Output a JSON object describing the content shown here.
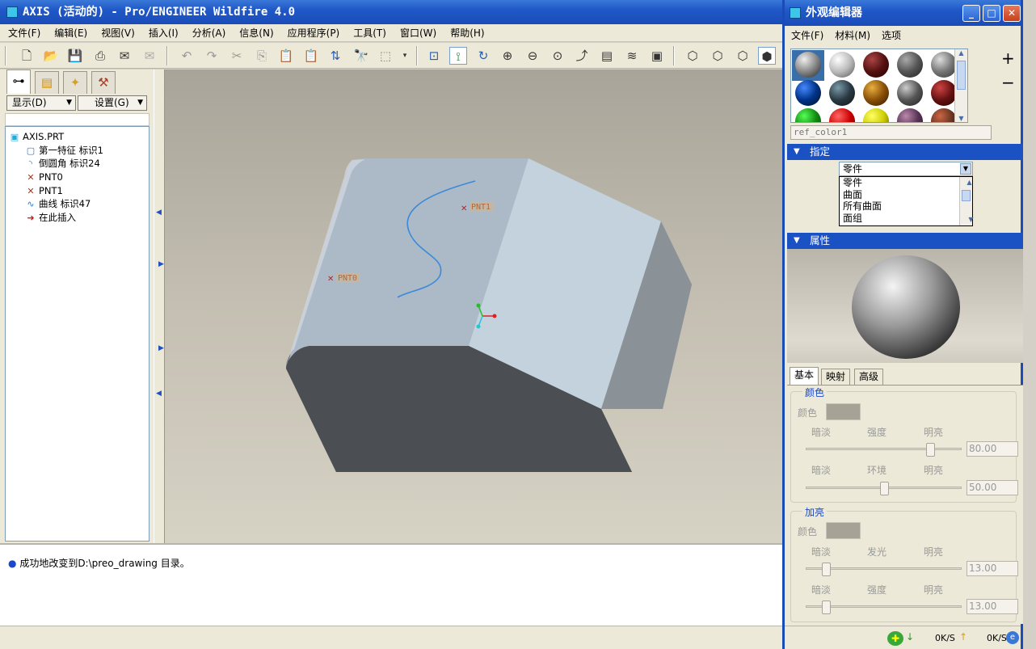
{
  "main": {
    "title": "AXIS (活动的) - Pro/ENGINEER Wildfire 4.0",
    "menu": [
      "文件(F)",
      "编辑(E)",
      "视图(V)",
      "插入(I)",
      "分析(A)",
      "信息(N)",
      "应用程序(P)",
      "工具(T)",
      "窗口(W)",
      "帮助(H)"
    ]
  },
  "leftpanel": {
    "show_label": "显示(D)",
    "settings_label": "设置(G)",
    "tree": [
      {
        "label": "AXIS.PRT",
        "icon": "part-icon"
      },
      {
        "label": "第一特征 标识1",
        "icon": "feature-icon"
      },
      {
        "label": "倒圆角 标识24",
        "icon": "round-icon"
      },
      {
        "label": "PNT0",
        "icon": "datum-point-icon"
      },
      {
        "label": "PNT1",
        "icon": "datum-point-icon"
      },
      {
        "label": "曲线 标识47",
        "icon": "curve-icon"
      },
      {
        "label": "在此插入",
        "icon": "insert-arrow-icon"
      }
    ]
  },
  "graphics": {
    "point_labels": [
      "PNT0",
      "PNT1"
    ]
  },
  "message": {
    "text": "成功地改变到D:\\preo_drawing 目录。"
  },
  "appearance_editor": {
    "title": "外观编辑器",
    "menu": [
      "文件(F)",
      "材料(M)",
      "选项"
    ],
    "ref_name": "ref_color1",
    "assign_header": "指定",
    "assign_value": "零件",
    "assign_options": [
      "零件",
      "曲面",
      "所有曲面",
      "面组"
    ],
    "properties_header": "属性",
    "tabs": [
      "基本",
      "映射",
      "高级"
    ],
    "color_group": {
      "title": "颜色",
      "color_label": "颜色",
      "row1": [
        "暗淡",
        "强度",
        "明亮"
      ],
      "value1": "80.00",
      "level1": 0.8,
      "row2": [
        "暗淡",
        "环境",
        "明亮"
      ],
      "value2": "50.00",
      "level2": 0.5
    },
    "highlight_group": {
      "title": "加亮",
      "color_label": "颜色",
      "row1": [
        "暗淡",
        "发光",
        "明亮"
      ],
      "value1": "13.00",
      "level1": 0.13,
      "row2": [
        "暗淡",
        "强度",
        "明亮"
      ],
      "value2": "13.00",
      "level2": 0.13
    },
    "status_left": "0K/S",
    "status_right": "0K/S"
  }
}
